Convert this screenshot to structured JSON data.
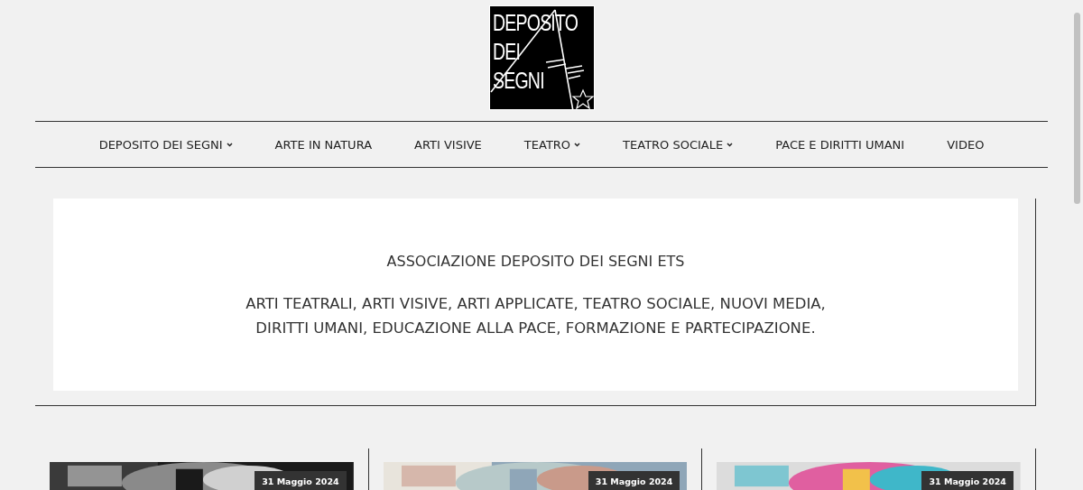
{
  "logo": {
    "lines": [
      "DEPOSITO",
      "DEI",
      "SEGNI"
    ]
  },
  "nav": [
    {
      "label": "DEPOSITO DEI SEGNI",
      "has_submenu": true
    },
    {
      "label": "ARTE IN NATURA",
      "has_submenu": false
    },
    {
      "label": "ARTI VISIVE",
      "has_submenu": false
    },
    {
      "label": "TEATRO",
      "has_submenu": true
    },
    {
      "label": "TEATRO SOCIALE",
      "has_submenu": true
    },
    {
      "label": "PACE E DIRITTI UMANI",
      "has_submenu": false
    },
    {
      "label": "VIDEO",
      "has_submenu": false
    }
  ],
  "hero": {
    "title": "ASSOCIAZIONE DEPOSITO DEI SEGNI ETS",
    "lines": [
      "ARTI TEATRALI, ARTI VISIVE, ARTI APPLICATE, TEATRO SOCIALE, NUOVI MEDIA,",
      "DIRITTI UMANI, EDUCAZIONE ALLA PACE, FORMAZIONE E PARTECIPAZIONE."
    ]
  },
  "posts": [
    {
      "kind": "picture",
      "date": "31 Maggio 2024"
    },
    {
      "kind": "picture",
      "date": "31 Maggio 2024"
    },
    {
      "kind": "picture",
      "date": "31 Maggio 2024"
    }
  ]
}
